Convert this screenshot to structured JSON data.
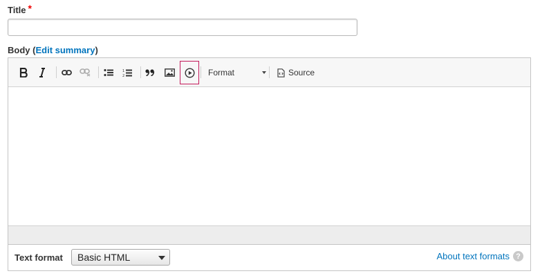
{
  "title_field": {
    "label": "Title",
    "required_marker": "*",
    "value": ""
  },
  "body_field": {
    "label": "Body",
    "paren_open": "(",
    "edit_summary_link": "Edit summary",
    "paren_close": ")"
  },
  "toolbar": {
    "format_label": "Format",
    "source_label": "Source",
    "buttons": [
      "bold-icon",
      "italic-icon",
      "link-icon",
      "unlink-icon",
      "bulleted-list-icon",
      "numbered-list-icon",
      "blockquote-icon",
      "image-icon",
      "video-play-icon"
    ]
  },
  "text_format": {
    "label": "Text format",
    "selected": "Basic HTML",
    "about_link": "About text formats",
    "help_glyph": "?"
  },
  "colors": {
    "link": "#0074bd",
    "required": "#e00000",
    "highlight_border": "#c3195a"
  }
}
